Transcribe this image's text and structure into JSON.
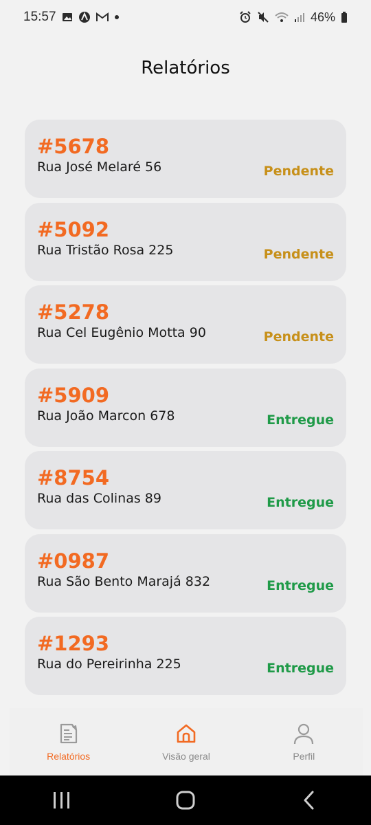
{
  "status_bar": {
    "time": "15:57",
    "battery": "46%"
  },
  "header": {
    "title": "Relatórios"
  },
  "reports": [
    {
      "id": "#5678",
      "address": "Rua José Melaré 56",
      "status": "Pendente",
      "status_color": "#c7901a"
    },
    {
      "id": "#5092",
      "address": "Rua Tristão Rosa 225",
      "status": "Pendente",
      "status_color": "#c7901a"
    },
    {
      "id": "#5278",
      "address": "Rua Cel Eugênio Motta 90",
      "status": "Pendente",
      "status_color": "#c7901a"
    },
    {
      "id": "#5909",
      "address": "Rua João Marcon 678",
      "status": "Entregue",
      "status_color": "#1f9a48"
    },
    {
      "id": "#8754",
      "address": "Rua das Colinas 89",
      "status": "Entregue",
      "status_color": "#1f9a48"
    },
    {
      "id": "#0987",
      "address": "Rua São Bento Marajá 832",
      "status": "Entregue",
      "status_color": "#1f9a48"
    },
    {
      "id": "#1293",
      "address": "Rua do Pereirinha 225",
      "status": "Entregue",
      "status_color": "#1f9a48"
    }
  ],
  "bottom_nav": {
    "items": [
      {
        "label": "Relatórios",
        "icon": "report-icon"
      },
      {
        "label": "Visão geral",
        "icon": "home-icon"
      },
      {
        "label": "Perfil",
        "icon": "user-icon"
      }
    ]
  },
  "colors": {
    "accent": "#f26a22",
    "pending": "#c7901a",
    "delivered": "#1f9a48",
    "card_bg": "#e5e5e7"
  }
}
